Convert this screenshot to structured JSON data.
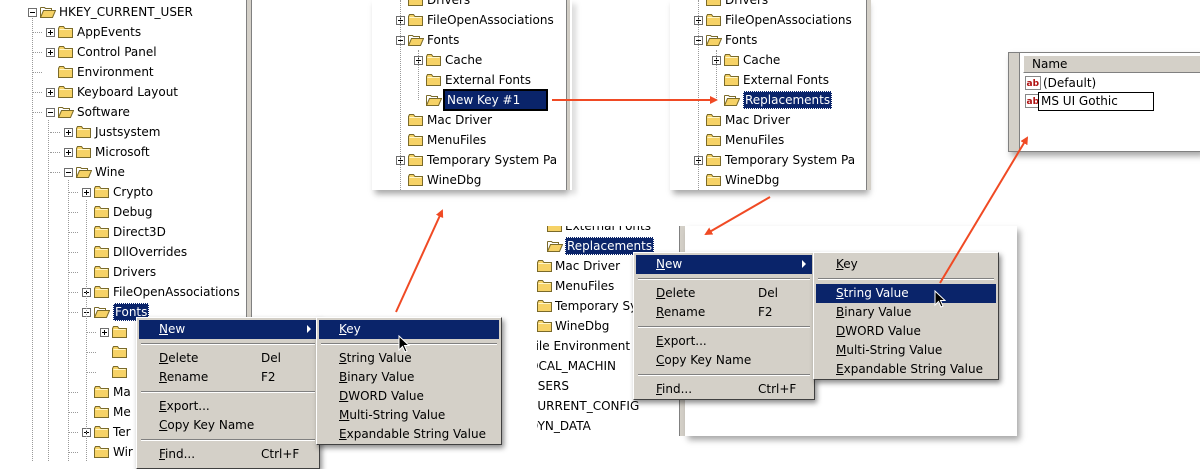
{
  "colors": {
    "selection": "#0a246a",
    "menu": "#d4d0c8",
    "arrow": "#f04a24",
    "folder": "#f6d266"
  },
  "tree1": {
    "items": [
      {
        "label": "HKEY_CURRENT_USER",
        "exp": "minus"
      },
      {
        "label": "AppEvents",
        "exp": "plus"
      },
      {
        "label": "Control Panel",
        "exp": "plus"
      },
      {
        "label": "Environment",
        "exp": ""
      },
      {
        "label": "Keyboard Layout",
        "exp": "plus"
      },
      {
        "label": "Software",
        "exp": "minus"
      },
      {
        "label": "Justsystem",
        "exp": "plus"
      },
      {
        "label": "Microsoft",
        "exp": "plus"
      },
      {
        "label": "Wine",
        "exp": "minus"
      },
      {
        "label": "Crypto",
        "exp": "plus"
      },
      {
        "label": "Debug",
        "exp": ""
      },
      {
        "label": "Direct3D",
        "exp": ""
      },
      {
        "label": "DllOverrides",
        "exp": ""
      },
      {
        "label": "Drivers",
        "exp": ""
      },
      {
        "label": "FileOpenAssociations",
        "exp": "plus"
      },
      {
        "label": "Fonts",
        "exp": "minus"
      },
      {
        "label": "",
        "exp": "plus"
      },
      {
        "label": "",
        "exp": ""
      },
      {
        "label": "",
        "exp": ""
      },
      {
        "label": "Ma",
        "exp": ""
      },
      {
        "label": "Me",
        "exp": ""
      },
      {
        "label": "Ter",
        "exp": "plus"
      },
      {
        "label": "Wir",
        "exp": ""
      }
    ]
  },
  "menu1": {
    "items": [
      {
        "label": "New",
        "u": "N",
        "rest": "ew",
        "key": "",
        "sub": true,
        "hl": true
      },
      {
        "label": "Delete",
        "u": "D",
        "rest": "elete",
        "key": "Del"
      },
      {
        "label": "Rename",
        "u": "R",
        "rest": "ename",
        "key": "F2"
      },
      {
        "label": "Export...",
        "u": "E",
        "rest": "xport...",
        "key": ""
      },
      {
        "label": "Copy Key Name",
        "u": "C",
        "rest": "opy Key Name",
        "key": ""
      },
      {
        "label": "Find...",
        "u": "F",
        "rest": "ind...",
        "key": "Ctrl+F"
      }
    ]
  },
  "submenu1": {
    "items": [
      {
        "u": "K",
        "rest": "ey",
        "hl": true
      },
      {
        "u": "S",
        "rest": "tring Value"
      },
      {
        "u": "B",
        "rest": "inary Value"
      },
      {
        "u": "D",
        "rest": "WORD Value"
      },
      {
        "u": "M",
        "rest": "ulti-String Value"
      },
      {
        "u": "E",
        "rest": "xpandable String Value"
      }
    ]
  },
  "tree2": {
    "items": [
      {
        "label": "Drivers",
        "exp": ""
      },
      {
        "label": "FileOpenAssociations",
        "exp": "plus"
      },
      {
        "label": "Fonts",
        "exp": "minus"
      },
      {
        "label": "Cache",
        "exp": "plus"
      },
      {
        "label": "External Fonts",
        "exp": ""
      },
      {
        "label": "New Key #1",
        "exp": ""
      },
      {
        "label": "Mac Driver",
        "exp": ""
      },
      {
        "label": "MenuFiles",
        "exp": ""
      },
      {
        "label": "Temporary System Pa",
        "exp": "plus"
      },
      {
        "label": "WineDbg",
        "exp": ""
      }
    ]
  },
  "tree3": {
    "items": [
      {
        "label": "Drivers",
        "exp": ""
      },
      {
        "label": "FileOpenAssociations",
        "exp": "plus"
      },
      {
        "label": "Fonts",
        "exp": "minus"
      },
      {
        "label": "Cache",
        "exp": "plus"
      },
      {
        "label": "External Fonts",
        "exp": ""
      },
      {
        "label": "Replacements",
        "exp": ""
      },
      {
        "label": "Mac Driver",
        "exp": ""
      },
      {
        "label": "MenuFiles",
        "exp": ""
      },
      {
        "label": "Temporary System Pa",
        "exp": "plus"
      },
      {
        "label": "WineDbg",
        "exp": ""
      }
    ]
  },
  "values": {
    "header": "Name",
    "rows": [
      {
        "label": "(Default)"
      },
      {
        "label": "MS UI Gothic"
      }
    ]
  },
  "tree4": {
    "items": [
      {
        "label": "External Fonts"
      },
      {
        "label": "Replacements"
      },
      {
        "label": "Mac Driver"
      },
      {
        "label": "MenuFiles"
      },
      {
        "label": "Temporary Sys"
      },
      {
        "label": "WineDbg"
      },
      {
        "label": "cile Environment"
      },
      {
        "label": "OCAL_MACHIN"
      },
      {
        "label": "USERS"
      },
      {
        "label": "CURRENT_CONFIG"
      },
      {
        "label": "DYN_DATA"
      }
    ]
  },
  "menu2": {
    "items": [
      {
        "u": "N",
        "rest": "ew",
        "key": "",
        "sub": true,
        "hl": true
      },
      {
        "u": "D",
        "rest": "elete",
        "key": "Del"
      },
      {
        "u": "R",
        "rest": "ename",
        "key": "F2"
      },
      {
        "u": "E",
        "rest": "xport...",
        "key": ""
      },
      {
        "u": "C",
        "rest": "opy Key Name",
        "key": ""
      },
      {
        "u": "F",
        "rest": "ind...",
        "key": "Ctrl+F"
      }
    ]
  },
  "submenu2": {
    "items": [
      {
        "u": "K",
        "rest": "ey"
      },
      {
        "u": "S",
        "rest": "tring Value",
        "hl": true
      },
      {
        "u": "B",
        "rest": "inary Value"
      },
      {
        "u": "D",
        "rest": "WORD Value"
      },
      {
        "u": "M",
        "rest": "ulti-String Value"
      },
      {
        "u": "E",
        "rest": "xpandable String Value"
      }
    ]
  }
}
